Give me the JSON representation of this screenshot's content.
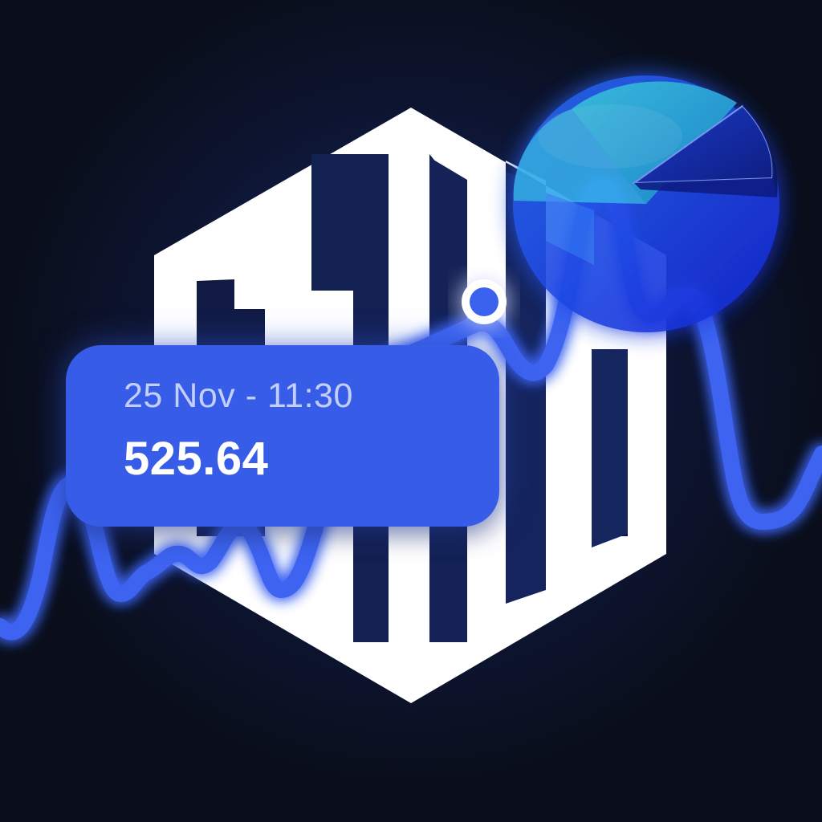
{
  "tooltip": {
    "timestamp": "25 Nov - 11:30",
    "value": "525.64"
  },
  "colors": {
    "background": "#0b0f1c",
    "glow": "#1d2c6b",
    "accent": "#375de8",
    "line": "#3d63f0",
    "logo": "#ffffff",
    "pie_cyan": "#2fb4e6",
    "pie_blue": "#1f3ff0"
  },
  "icons": {
    "logo": "bar-chart-hexagon-icon",
    "pie": "pie-chart-icon",
    "marker": "data-point-marker-icon"
  }
}
